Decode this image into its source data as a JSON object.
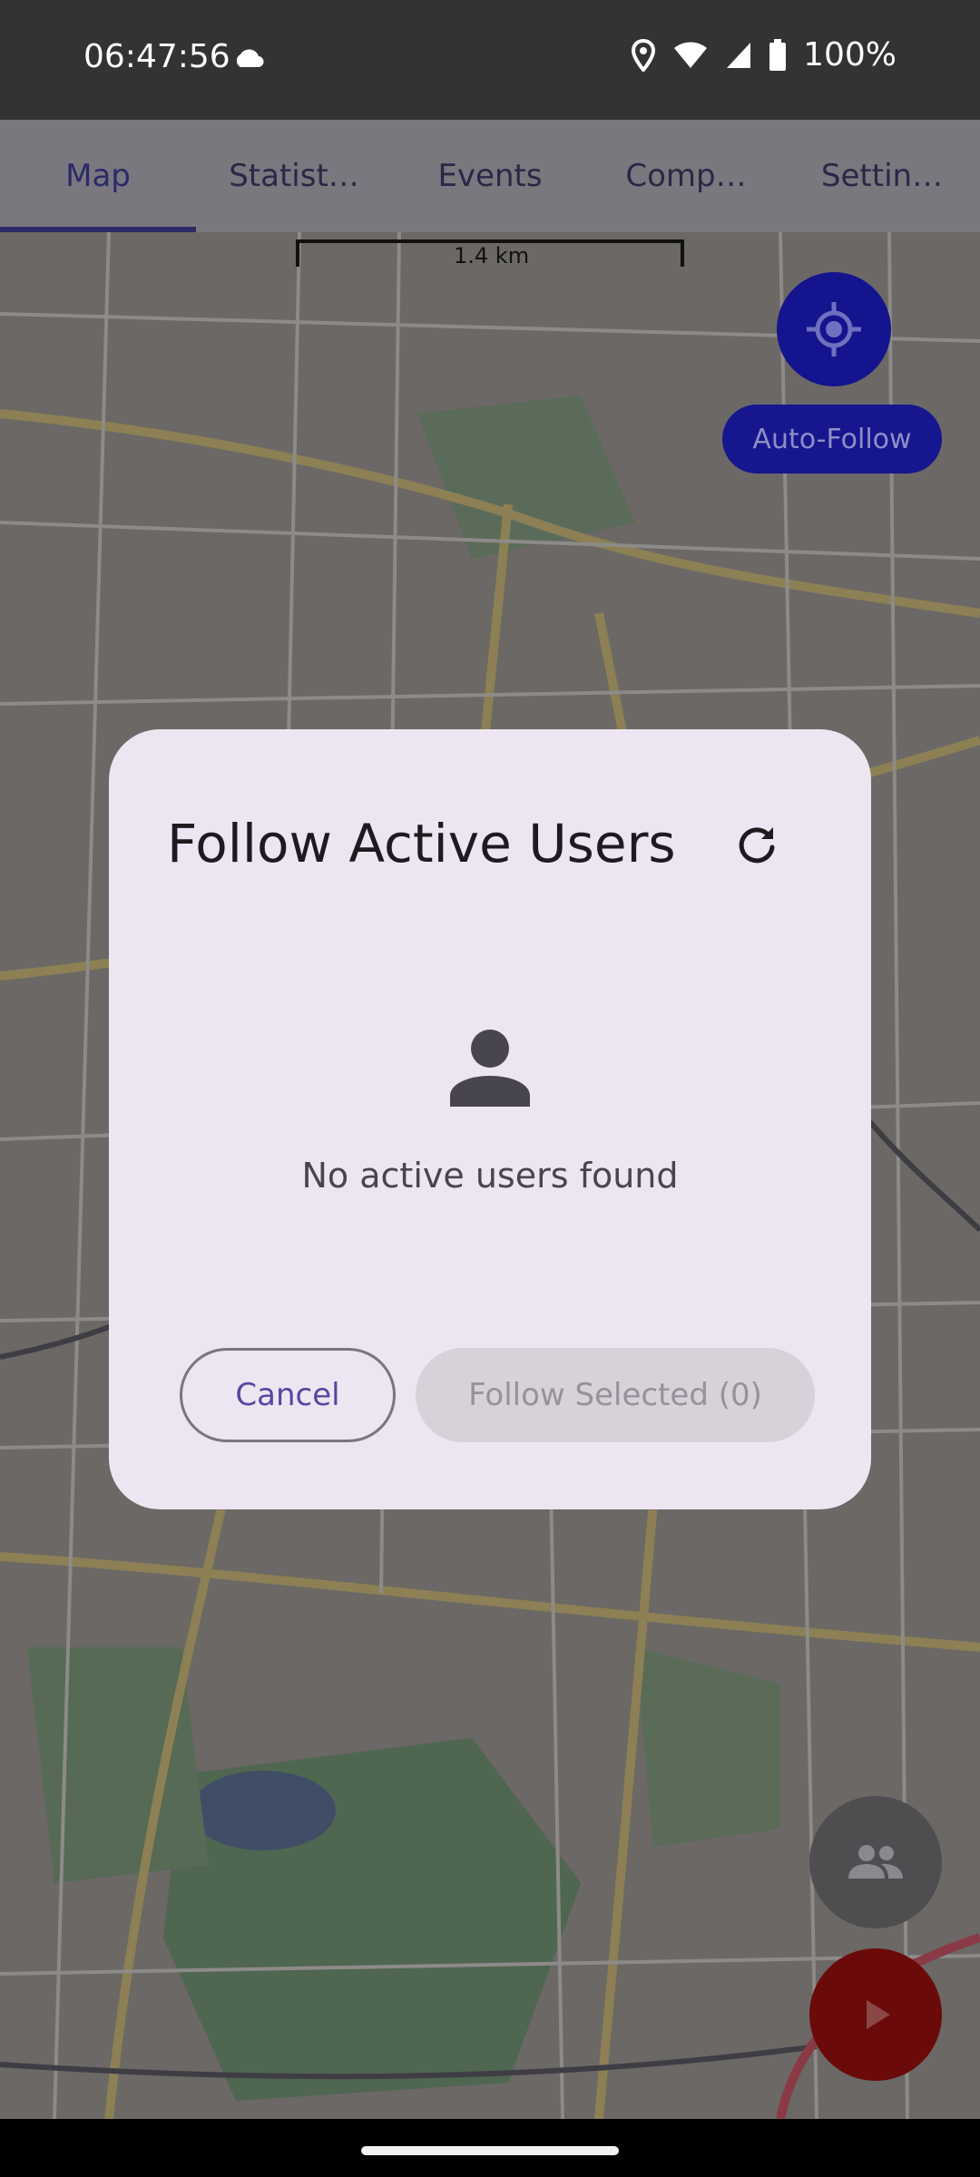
{
  "status_bar": {
    "time": "06:47:56",
    "battery": "100%",
    "icons": [
      "cloud-icon",
      "location-icon",
      "wifi-icon",
      "signal-icon",
      "battery-icon"
    ]
  },
  "tabs": [
    {
      "label": "Map",
      "active": true
    },
    {
      "label": "Statist…",
      "active": false
    },
    {
      "label": "Events",
      "active": false
    },
    {
      "label": "Comp…",
      "active": false
    },
    {
      "label": "Settin…",
      "active": false
    }
  ],
  "map": {
    "scale_label": "1.4 km",
    "auto_follow_label": "Auto-Follow"
  },
  "dialog": {
    "title": "Follow Active Users",
    "empty_message": "No active users found",
    "cancel_label": "Cancel",
    "follow_label": "Follow Selected (0)"
  },
  "colors": {
    "accent": "#5a45a0",
    "dialog_bg": "#ede6f2",
    "locate_button": "#14148e",
    "record_button": "#6b0a0a"
  }
}
